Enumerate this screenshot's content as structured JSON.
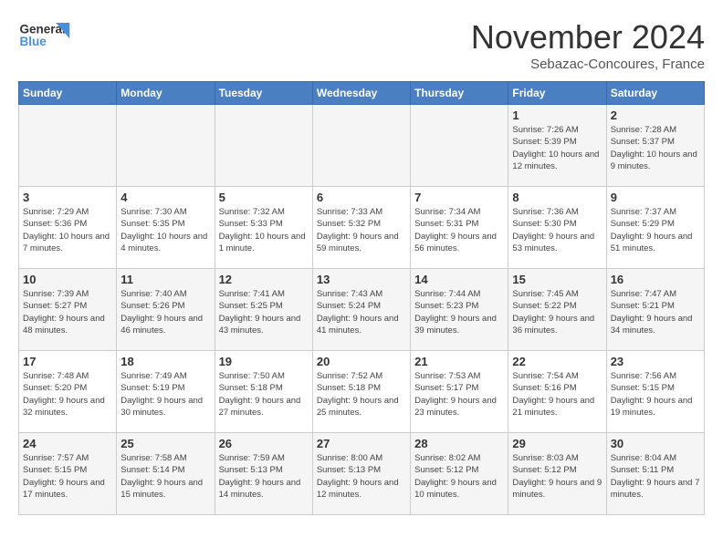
{
  "logo": {
    "line1": "General",
    "line2": "Blue"
  },
  "title": "November 2024",
  "subtitle": "Sebazac-Concoures, France",
  "weekdays": [
    "Sunday",
    "Monday",
    "Tuesday",
    "Wednesday",
    "Thursday",
    "Friday",
    "Saturday"
  ],
  "weeks": [
    [
      {
        "day": "",
        "info": ""
      },
      {
        "day": "",
        "info": ""
      },
      {
        "day": "",
        "info": ""
      },
      {
        "day": "",
        "info": ""
      },
      {
        "day": "",
        "info": ""
      },
      {
        "day": "1",
        "info": "Sunrise: 7:26 AM\nSunset: 5:39 PM\nDaylight: 10 hours and 12 minutes."
      },
      {
        "day": "2",
        "info": "Sunrise: 7:28 AM\nSunset: 5:37 PM\nDaylight: 10 hours and 9 minutes."
      }
    ],
    [
      {
        "day": "3",
        "info": "Sunrise: 7:29 AM\nSunset: 5:36 PM\nDaylight: 10 hours and 7 minutes."
      },
      {
        "day": "4",
        "info": "Sunrise: 7:30 AM\nSunset: 5:35 PM\nDaylight: 10 hours and 4 minutes."
      },
      {
        "day": "5",
        "info": "Sunrise: 7:32 AM\nSunset: 5:33 PM\nDaylight: 10 hours and 1 minute."
      },
      {
        "day": "6",
        "info": "Sunrise: 7:33 AM\nSunset: 5:32 PM\nDaylight: 9 hours and 59 minutes."
      },
      {
        "day": "7",
        "info": "Sunrise: 7:34 AM\nSunset: 5:31 PM\nDaylight: 9 hours and 56 minutes."
      },
      {
        "day": "8",
        "info": "Sunrise: 7:36 AM\nSunset: 5:30 PM\nDaylight: 9 hours and 53 minutes."
      },
      {
        "day": "9",
        "info": "Sunrise: 7:37 AM\nSunset: 5:29 PM\nDaylight: 9 hours and 51 minutes."
      }
    ],
    [
      {
        "day": "10",
        "info": "Sunrise: 7:39 AM\nSunset: 5:27 PM\nDaylight: 9 hours and 48 minutes."
      },
      {
        "day": "11",
        "info": "Sunrise: 7:40 AM\nSunset: 5:26 PM\nDaylight: 9 hours and 46 minutes."
      },
      {
        "day": "12",
        "info": "Sunrise: 7:41 AM\nSunset: 5:25 PM\nDaylight: 9 hours and 43 minutes."
      },
      {
        "day": "13",
        "info": "Sunrise: 7:43 AM\nSunset: 5:24 PM\nDaylight: 9 hours and 41 minutes."
      },
      {
        "day": "14",
        "info": "Sunrise: 7:44 AM\nSunset: 5:23 PM\nDaylight: 9 hours and 39 minutes."
      },
      {
        "day": "15",
        "info": "Sunrise: 7:45 AM\nSunset: 5:22 PM\nDaylight: 9 hours and 36 minutes."
      },
      {
        "day": "16",
        "info": "Sunrise: 7:47 AM\nSunset: 5:21 PM\nDaylight: 9 hours and 34 minutes."
      }
    ],
    [
      {
        "day": "17",
        "info": "Sunrise: 7:48 AM\nSunset: 5:20 PM\nDaylight: 9 hours and 32 minutes."
      },
      {
        "day": "18",
        "info": "Sunrise: 7:49 AM\nSunset: 5:19 PM\nDaylight: 9 hours and 30 minutes."
      },
      {
        "day": "19",
        "info": "Sunrise: 7:50 AM\nSunset: 5:18 PM\nDaylight: 9 hours and 27 minutes."
      },
      {
        "day": "20",
        "info": "Sunrise: 7:52 AM\nSunset: 5:18 PM\nDaylight: 9 hours and 25 minutes."
      },
      {
        "day": "21",
        "info": "Sunrise: 7:53 AM\nSunset: 5:17 PM\nDaylight: 9 hours and 23 minutes."
      },
      {
        "day": "22",
        "info": "Sunrise: 7:54 AM\nSunset: 5:16 PM\nDaylight: 9 hours and 21 minutes."
      },
      {
        "day": "23",
        "info": "Sunrise: 7:56 AM\nSunset: 5:15 PM\nDaylight: 9 hours and 19 minutes."
      }
    ],
    [
      {
        "day": "24",
        "info": "Sunrise: 7:57 AM\nSunset: 5:15 PM\nDaylight: 9 hours and 17 minutes."
      },
      {
        "day": "25",
        "info": "Sunrise: 7:58 AM\nSunset: 5:14 PM\nDaylight: 9 hours and 15 minutes."
      },
      {
        "day": "26",
        "info": "Sunrise: 7:59 AM\nSunset: 5:13 PM\nDaylight: 9 hours and 14 minutes."
      },
      {
        "day": "27",
        "info": "Sunrise: 8:00 AM\nSunset: 5:13 PM\nDaylight: 9 hours and 12 minutes."
      },
      {
        "day": "28",
        "info": "Sunrise: 8:02 AM\nSunset: 5:12 PM\nDaylight: 9 hours and 10 minutes."
      },
      {
        "day": "29",
        "info": "Sunrise: 8:03 AM\nSunset: 5:12 PM\nDaylight: 9 hours and 9 minutes."
      },
      {
        "day": "30",
        "info": "Sunrise: 8:04 AM\nSunset: 5:11 PM\nDaylight: 9 hours and 7 minutes."
      }
    ]
  ]
}
